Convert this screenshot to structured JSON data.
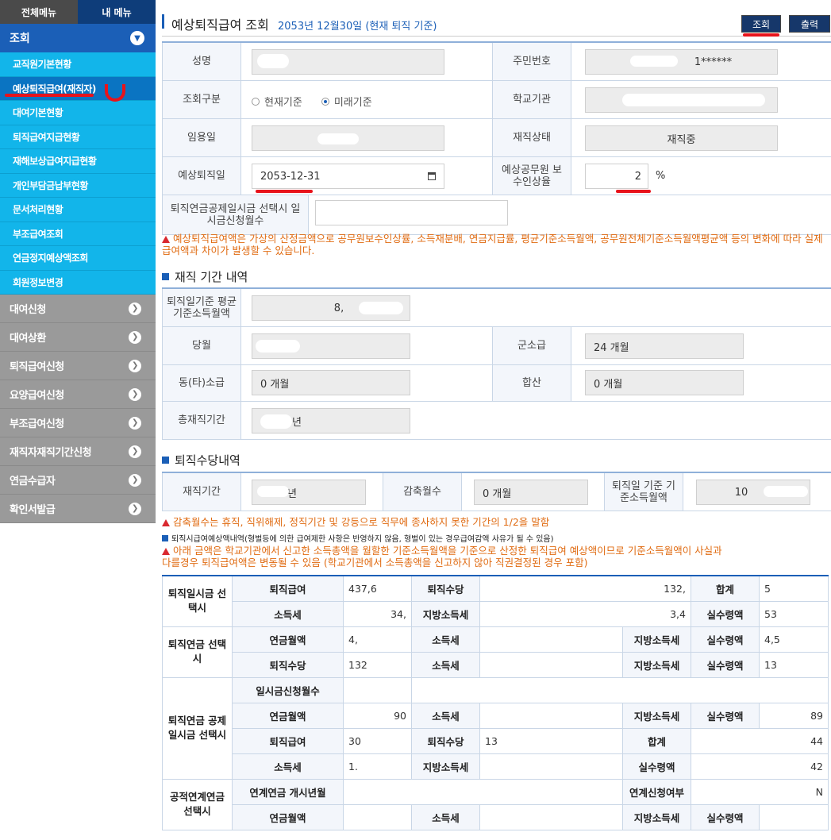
{
  "sidebar": {
    "tab_all": "전체메뉴",
    "tab_mine": "내 메뉴",
    "open_menu": "조회",
    "sub_items": [
      "교직원기본현황",
      "예상퇴직급여(재직자)",
      "대여기본현황",
      "퇴직급여지급현황",
      "재해보상급여지급현황",
      "개인부담금납부현황",
      "문서처리현황",
      "부조급여조회",
      "연금정지예상액조회",
      "회원정보변경"
    ],
    "closed_menus": [
      "대여신청",
      "대여상환",
      "퇴직급여신청",
      "요양급여신청",
      "부조급여신청",
      "재직자재직기간신청",
      "연금수급자",
      "확인서발급"
    ]
  },
  "header": {
    "title": "예상퇴직급여 조회",
    "subtitle": "2053년 12월30일 (현재 퇴직 기준)",
    "search_label": "조회",
    "print_label": "출력"
  },
  "form": {
    "name_label": "성명",
    "rrn_label": "주민번호",
    "rrn_value": "1******",
    "type_label": "조회구분",
    "radio_current": "현재기준",
    "radio_future": "미래기준",
    "school_label": "학교기관",
    "hire_label": "임용일",
    "status_label": "재직상태",
    "status_value": "재직중",
    "retire_label": "예상퇴직일",
    "retire_value": "2053-12-31",
    "raise_label": "예상공무원 보수인상율",
    "raise_value": "2",
    "raise_unit": "%",
    "lump_label": "퇴직연금공제일시금 선택시 일시금신청월수",
    "warning": "예상퇴직급여액은 가상의 산정금액으로 공무원보수인상률, 소득재분배, 연금지급률, 평균기준소득월액, 공무원전체기준소득월액평균액  등의 변화에 따라 실제 급여액과 차이가 발생할 수 있습니다."
  },
  "service": {
    "section_title": "재직 기간 내역",
    "avg_label": "퇴직일기준 평균기준소득월액",
    "avg_value": "8,",
    "dang_label": "당월",
    "military_label": "군소급",
    "military_value": "24 개월",
    "other_label": "동(타)소급",
    "other_value": "0 개월",
    "sum_label": "합산",
    "sum_value": "0 개월",
    "total_label": "총재직기간",
    "total_value": "년"
  },
  "allowance": {
    "section_title": "퇴직수당내역",
    "period_label": "재직기간",
    "period_value": "년",
    "reduce_label": "감축월수",
    "reduce_value": "0 개월",
    "base_label": "퇴직일 기준 기준소득월액",
    "base_value": "10",
    "note1": "감축월수는 휴직, 직위해제, 정직기간 및 강등으로 직무에 종사하지 못한 기간의 1/2을 말함",
    "note2": "퇴직시급여예상액내역(형벌등에 의한 급여제한 사항은 반영하지 않음, 형벌이 있는 경우급여감액 사유가 될 수 있음)",
    "note3": "아래 금액은 학교기관에서 신고한 소득총액을 월할한 기준소득월액을 기준으로 산정한 퇴직급여 예상액이므로 기준소득월액이 사실과 다를경우 퇴직급여액은 변동될 수 있음 (학교기관에서 소득총액을 신고하지 않아 직권결정된 경우 포함)"
  },
  "table": {
    "g1": "퇴직일시금 선택시",
    "g2": "퇴직연금 선택시",
    "g3": "퇴직연금 공제일시금 선택시",
    "g4": "공적연계연금 선택시",
    "retire_pay": "퇴직급여",
    "allowance": "퇴직수당",
    "total": "합계",
    "income_tax": "소득세",
    "local_tax": "지방소득세",
    "net": "실수령액",
    "pension_month": "연금월액",
    "lump_months": "일시금신청월수",
    "link_start": "연계연금 개시년월",
    "link_apply": "연계신청여부",
    "r1_pay": "437,6",
    "r1_allow": "132,",
    "r1_total": "5",
    "r2_tax": "34,",
    "r2_local": "3,4",
    "r2_net": "53",
    "r3_month": "4,",
    "r3_net": "4,5",
    "r4_allow": "132",
    "r4_net": "13",
    "r5_month": "90",
    "r5_net": "89",
    "r6_pay": "30",
    "r6_allow": "13",
    "r6_total": "44",
    "r7_tax": "1.",
    "r7_net": "42",
    "link_apply_value": "N"
  }
}
